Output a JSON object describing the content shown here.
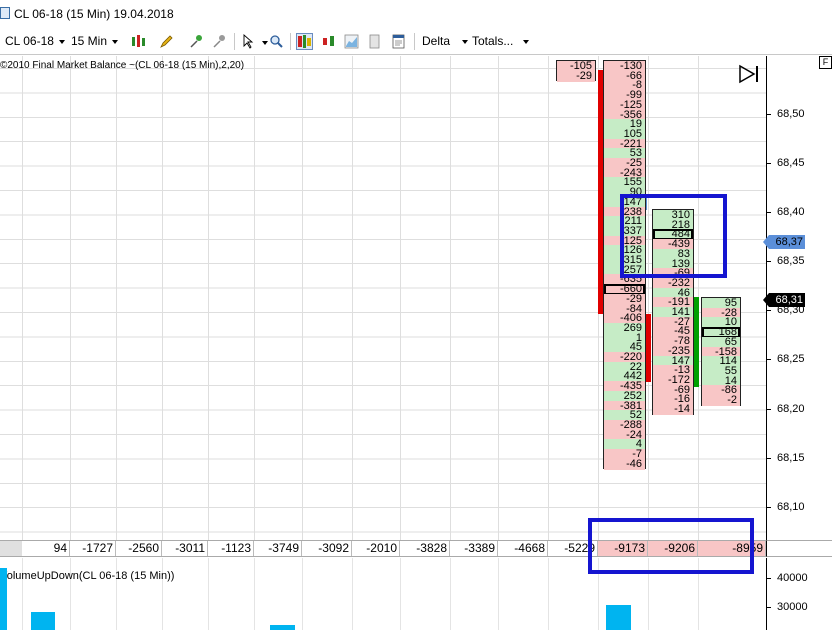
{
  "window": {
    "title": "CL 06-18 (15 Min)  19.04.2018"
  },
  "toolbar": {
    "instrument": "CL 06-18",
    "interval": "15 Min",
    "delta_label": "Delta",
    "totals_label": "Totals..."
  },
  "chart": {
    "indicator_label": "©2010 Final Market Balance ~(CL 06-18 (15 Min),2,20)",
    "price_axis": [
      "68,50",
      "68,45",
      "68,40",
      "68,35",
      "68,30",
      "68,25",
      "68,20",
      "68,15",
      "68,10"
    ],
    "price_tags": [
      {
        "value": "68,37",
        "bg": "#5b8fd9",
        "fg": "#000000"
      },
      {
        "value": "68,31",
        "bg": "#000000",
        "fg": "#ffffff"
      }
    ],
    "corner_button": "F",
    "colors": {
      "positive": "#c6ecc6",
      "negative": "#f8c6c6",
      "highlight": "#1515d0",
      "bar_red": "#e00000",
      "bar_green": "#00a000",
      "volume": "#00b4f0"
    },
    "footprint": [
      {
        "cells": [
          {
            "v": "-105",
            "s": "neg"
          },
          {
            "v": "-29",
            "s": "neg"
          }
        ]
      },
      {
        "cells": [
          {
            "v": "-130",
            "s": "neg"
          },
          {
            "v": "-66",
            "s": "neg"
          },
          {
            "v": "-8",
            "s": "neg"
          },
          {
            "v": "-99",
            "s": "neg"
          },
          {
            "v": "-125",
            "s": "neg"
          },
          {
            "v": "-356",
            "s": "neg"
          },
          {
            "v": "19",
            "s": "pos"
          },
          {
            "v": "105",
            "s": "pos"
          },
          {
            "v": "-221",
            "s": "neg"
          },
          {
            "v": "53",
            "s": "pos"
          },
          {
            "v": "-25",
            "s": "neg"
          },
          {
            "v": "-243",
            "s": "neg"
          },
          {
            "v": "155",
            "s": "pos"
          },
          {
            "v": "90",
            "s": "pos"
          },
          {
            "v": "147",
            "s": "pos"
          },
          {
            "v": "-238",
            "s": "neg"
          },
          {
            "v": "211",
            "s": "pos"
          },
          {
            "v": "337",
            "s": "pos"
          },
          {
            "v": "-125",
            "s": "neg"
          },
          {
            "v": "126",
            "s": "pos"
          },
          {
            "v": "315",
            "s": "pos"
          },
          {
            "v": "257",
            "s": "pos"
          },
          {
            "v": "-635",
            "s": "neg"
          },
          {
            "v": "-660",
            "s": "neg",
            "poc": true
          },
          {
            "v": "-29",
            "s": "neg"
          },
          {
            "v": "-84",
            "s": "neg"
          },
          {
            "v": "-406",
            "s": "neg"
          },
          {
            "v": "269",
            "s": "pos"
          },
          {
            "v": "1",
            "s": "pos"
          },
          {
            "v": "45",
            "s": "pos"
          },
          {
            "v": "-220",
            "s": "neg"
          },
          {
            "v": "22",
            "s": "pos"
          },
          {
            "v": "442",
            "s": "pos"
          },
          {
            "v": "-435",
            "s": "neg"
          },
          {
            "v": "252",
            "s": "pos"
          },
          {
            "v": "-381",
            "s": "neg"
          },
          {
            "v": "52",
            "s": "pos"
          },
          {
            "v": "-288",
            "s": "neg"
          },
          {
            "v": "-24",
            "s": "neg"
          },
          {
            "v": "4",
            "s": "pos"
          },
          {
            "v": "-7",
            "s": "neg"
          },
          {
            "v": "-46",
            "s": "neg"
          }
        ]
      },
      {
        "cells": [
          {
            "v": "310",
            "s": "pos"
          },
          {
            "v": "218",
            "s": "pos"
          },
          {
            "v": "484",
            "s": "pos",
            "poc": true
          },
          {
            "v": "-439",
            "s": "neg"
          },
          {
            "v": "83",
            "s": "pos"
          },
          {
            "v": "139",
            "s": "pos"
          },
          {
            "v": "-69",
            "s": "neg"
          },
          {
            "v": "-232",
            "s": "neg"
          },
          {
            "v": "46",
            "s": "pos"
          },
          {
            "v": "-191",
            "s": "neg"
          },
          {
            "v": "141",
            "s": "pos"
          },
          {
            "v": "-27",
            "s": "neg"
          },
          {
            "v": "-45",
            "s": "neg"
          },
          {
            "v": "-78",
            "s": "neg"
          },
          {
            "v": "-235",
            "s": "neg"
          },
          {
            "v": "147",
            "s": "pos"
          },
          {
            "v": "-13",
            "s": "neg"
          },
          {
            "v": "-172",
            "s": "neg"
          },
          {
            "v": "-69",
            "s": "neg"
          },
          {
            "v": "-16",
            "s": "neg"
          },
          {
            "v": "-14",
            "s": "neg"
          }
        ]
      },
      {
        "cells": [
          {
            "v": "95",
            "s": "pos"
          },
          {
            "v": "-28",
            "s": "neg"
          },
          {
            "v": "10",
            "s": "pos"
          },
          {
            "v": "168",
            "s": "pos",
            "poc": true
          },
          {
            "v": "65",
            "s": "pos"
          },
          {
            "v": "-158",
            "s": "neg"
          },
          {
            "v": "114",
            "s": "pos"
          },
          {
            "v": "55",
            "s": "pos"
          },
          {
            "v": "14",
            "s": "pos"
          },
          {
            "v": "-86",
            "s": "neg"
          },
          {
            "v": "-2",
            "s": "neg"
          }
        ]
      }
    ]
  },
  "totals": [
    "94",
    "-1727",
    "-2560",
    "-3011",
    "-1123",
    "-3749",
    "-3092",
    "-2010",
    "-3828",
    "-3389",
    "-4668",
    "-5229",
    "-9173",
    "-9206",
    "-8959"
  ],
  "lower_panel": {
    "label": "VolumeUpDown(CL 06-18 (15 Min))",
    "axis": [
      "40000",
      "30000"
    ]
  }
}
